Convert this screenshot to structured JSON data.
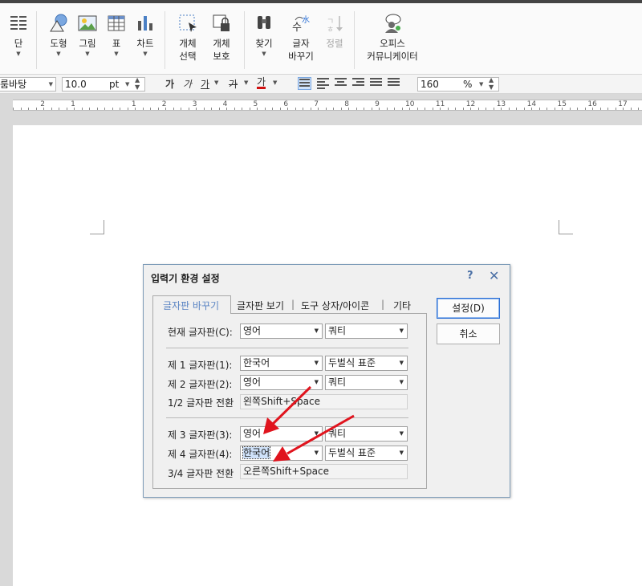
{
  "ribbon": {
    "items": [
      {
        "label": "단",
        "icon": "columns-icon"
      },
      {
        "label": "도형",
        "icon": "shape-icon"
      },
      {
        "label": "그림",
        "icon": "picture-icon"
      },
      {
        "label": "표",
        "icon": "table-icon"
      },
      {
        "label": "차트",
        "icon": "chart-icon"
      },
      {
        "label": "개체\n선택",
        "icon": "select-object-icon"
      },
      {
        "label": "개체\n보호",
        "icon": "protect-object-icon"
      },
      {
        "label": "찾기",
        "icon": "find-icon"
      },
      {
        "label": "글자\n바꾸기",
        "icon": "replace-icon"
      },
      {
        "label": "정렬",
        "icon": "sort-icon"
      },
      {
        "label": "오피스\n커뮤니케이터",
        "icon": "communicator-icon"
      }
    ]
  },
  "format_bar": {
    "font": "룸바탕",
    "size": "10.0",
    "unit": "pt",
    "zoom": "160",
    "zoom_unit": "%"
  },
  "ruler": {
    "numbers": [
      "2",
      "1",
      "1",
      "2",
      "3",
      "4",
      "5",
      "6",
      "7",
      "8",
      "9",
      "10",
      "11",
      "12",
      "13",
      "14",
      "15",
      "16",
      "17"
    ]
  },
  "dialog": {
    "title": "입력기 환경 설정",
    "help": "?",
    "close": "✕",
    "tabs": [
      "글자판 바꾸기",
      "글자판 보기",
      "도구 상자/아이콘",
      "기타"
    ],
    "current_label": "현재 글자판(C):",
    "current_lang": "영어",
    "current_layout": "쿼티",
    "kb1_label": "제 1 글자판(1):",
    "kb1_lang": "한국어",
    "kb1_layout": "두벌식 표준",
    "kb2_label": "제 2 글자판(2):",
    "kb2_lang": "영어",
    "kb2_layout": "쿼티",
    "switch12_label": "1/2 글자판 전환",
    "switch12_value": "왼쪽Shift+Space",
    "kb3_label": "제 3 글자판(3):",
    "kb3_lang": "영어",
    "kb3_layout": "쿼티",
    "kb4_label": "제 4 글자판(4):",
    "kb4_lang": "한국어",
    "kb4_layout": "두벌식 표준",
    "switch34_label": "3/4 글자판 전환",
    "switch34_value": "오른쪽Shift+Space",
    "ok_button": "설정(D)",
    "cancel_button": "취소"
  },
  "colors": {
    "annotation_arrow": "#e0141e",
    "accent": "#2a6fd6"
  }
}
